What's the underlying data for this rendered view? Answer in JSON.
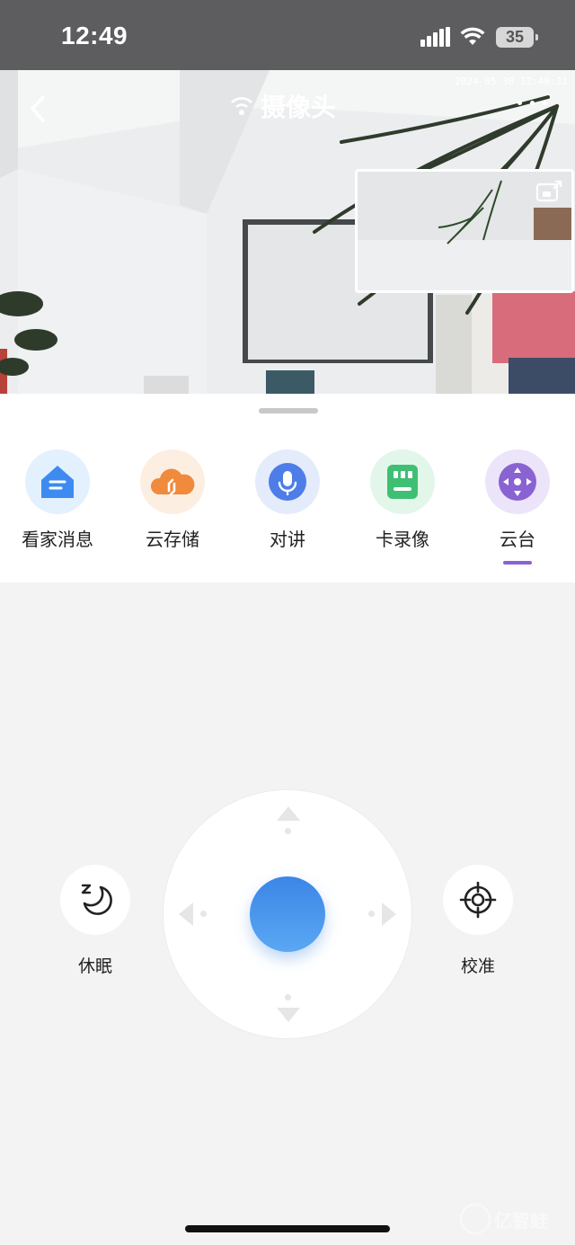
{
  "status_bar": {
    "time": "12:49",
    "battery": "35"
  },
  "video": {
    "title": "摄像头",
    "timestamp": "2024-05-30 12:49:31"
  },
  "features": [
    {
      "label": "看家消息",
      "icon": "home-shield-icon",
      "color": "#3d8bf0"
    },
    {
      "label": "云存储",
      "icon": "cloud-storage-icon",
      "color": "#f08a3c"
    },
    {
      "label": "对讲",
      "icon": "microphone-icon",
      "color": "#4e7de8"
    },
    {
      "label": "卡录像",
      "icon": "sd-card-icon",
      "color": "#3fbf73"
    },
    {
      "label": "云台",
      "icon": "ptz-icon",
      "color": "#8a63d2",
      "selected": true
    }
  ],
  "ptz": {
    "sleep_label": "休眠",
    "calibrate_label": "校准"
  },
  "watermark": "亿智蛙"
}
